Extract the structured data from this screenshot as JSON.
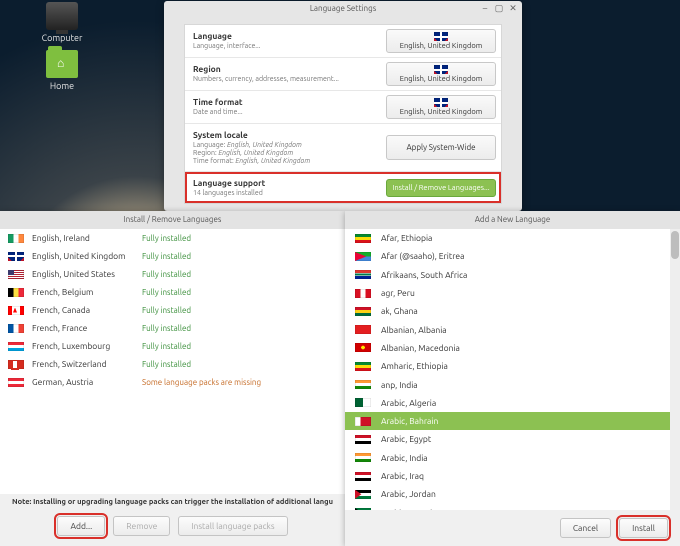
{
  "desktop": {
    "icons": [
      {
        "label": "Computer"
      },
      {
        "label": "Home"
      }
    ]
  },
  "ls_window": {
    "title": "Language Settings",
    "rows": {
      "language": {
        "hdr": "Language",
        "sub": "Language, interface...",
        "value": "English, United Kingdom"
      },
      "region": {
        "hdr": "Region",
        "sub": "Numbers, currency, addresses, measurement...",
        "value": "English, United Kingdom"
      },
      "timefmt": {
        "hdr": "Time format",
        "sub": "Date and time...",
        "value": "English, United Kingdom"
      },
      "locale": {
        "hdr": "System locale",
        "sub1_k": "Language:",
        "sub1_v": "English, United Kingdom",
        "sub2_k": "Region:",
        "sub2_v": "English, United Kingdom",
        "sub3_k": "Time format:",
        "sub3_v": "English, United Kingdom",
        "apply": "Apply System-Wide"
      },
      "support": {
        "hdr": "Language support",
        "sub": "14 languages installed",
        "btn": "Install / Remove Languages..."
      }
    }
  },
  "irl": {
    "title": "Install / Remove Languages",
    "status_full": "Fully installed",
    "status_missing": "Some language packs are missing",
    "items": [
      {
        "flag": "ie",
        "name": "English, Ireland",
        "status": "full"
      },
      {
        "flag": "uk",
        "name": "English, United Kingdom",
        "status": "full"
      },
      {
        "flag": "us",
        "name": "English, United States",
        "status": "full"
      },
      {
        "flag": "be",
        "name": "French, Belgium",
        "status": "full"
      },
      {
        "flag": "ca",
        "name": "French, Canada",
        "status": "full"
      },
      {
        "flag": "fr",
        "name": "French, France",
        "status": "full"
      },
      {
        "flag": "lu",
        "name": "French, Luxembourg",
        "status": "full"
      },
      {
        "flag": "ch",
        "name": "French, Switzerland",
        "status": "full"
      },
      {
        "flag": "at",
        "name": "German, Austria",
        "status": "missing"
      }
    ],
    "note": "Note: Installing or upgrading language packs can trigger the installation of additional langu",
    "buttons": {
      "add": "Add...",
      "remove": "Remove",
      "packs": "Install language packs"
    }
  },
  "anl": {
    "title": "Add a New Language",
    "items": [
      {
        "flag": "et",
        "name": "Afar, Ethiopia"
      },
      {
        "flag": "er",
        "name": "Afar (@saaho), Eritrea"
      },
      {
        "flag": "za",
        "name": "Afrikaans, South Africa"
      },
      {
        "flag": "pe",
        "name": "agr, Peru"
      },
      {
        "flag": "gh",
        "name": "ak, Ghana"
      },
      {
        "flag": "al",
        "name": "Albanian, Albania"
      },
      {
        "flag": "mk",
        "name": "Albanian, Macedonia"
      },
      {
        "flag": "et",
        "name": "Amharic, Ethiopia"
      },
      {
        "flag": "in",
        "name": "anp, India"
      },
      {
        "flag": "dz",
        "name": "Arabic, Algeria"
      },
      {
        "flag": "bh",
        "name": "Arabic, Bahrain",
        "selected": true
      },
      {
        "flag": "eg",
        "name": "Arabic, Egypt"
      },
      {
        "flag": "in",
        "name": "Arabic, India"
      },
      {
        "flag": "iq",
        "name": "Arabic, Iraq"
      },
      {
        "flag": "jo",
        "name": "Arabic, Jordan"
      },
      {
        "flag": "kw",
        "name": "Arabic, Kuwait"
      }
    ],
    "buttons": {
      "cancel": "Cancel",
      "install": "Install"
    }
  }
}
